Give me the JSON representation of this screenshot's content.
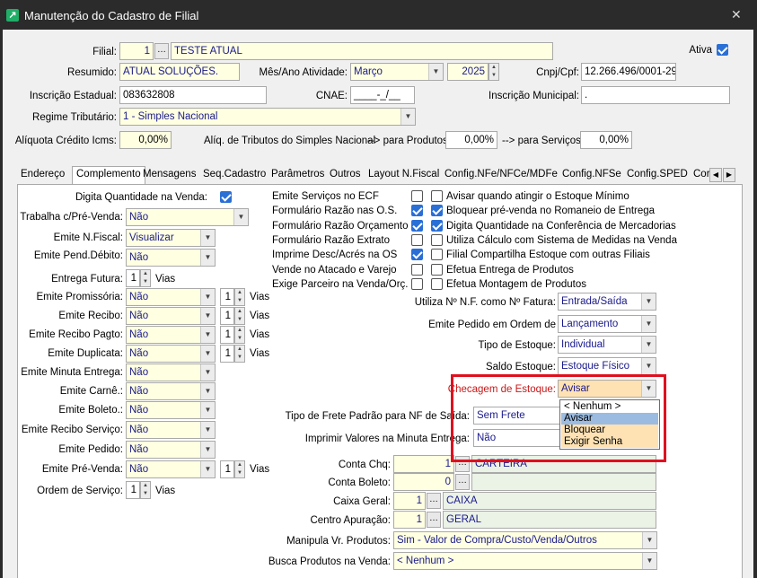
{
  "window": {
    "title": "Manutenção do Cadastro de Filial",
    "close_glyph": "✕"
  },
  "header": {
    "filial_label": "Filial:",
    "filial_code": "1",
    "filial_name": "TESTE ATUAL",
    "ativa_label": "Ativa",
    "resumido_label": "Resumido:",
    "resumido_value": "ATUAL SOLUÇÕES.",
    "mes_ano_label": "Mês/Ano Atividade:",
    "mes_value": "Março",
    "ano_value": "2025",
    "cnpj_label": "Cnpj/Cpf:",
    "cnpj_value": "12.266.496/0001-29",
    "ie_label": "Inscrição Estadual:",
    "ie_value": "083632808",
    "cnae_label": "CNAE:",
    "cnae_value": "____-_/__",
    "im_label": "Inscrição Municipal:",
    "im_value": ".",
    "regime_label": "Regime Tributário:",
    "regime_value": "1 - Simples Nacional",
    "aliq_icms_label": "Alíquota Crédito Icms:",
    "aliq_icms_value": "0,00%",
    "aliq_simples_label": "Alíq. de Tributos do Simples Nacional",
    "produtos_label": "--> para Produtos:",
    "produtos_value": "0,00%",
    "servicos_label": "--> para Serviços:",
    "servicos_value": "0,00%"
  },
  "tabs": [
    "Endereço",
    "Complemento",
    "Mensagens",
    "Seq.Cadastro",
    "Parâmetros",
    "Outros",
    "Layout N.Fiscal",
    "Config.NFe/NFCe/MDFe",
    "Config.NFSe",
    "Config.SPED",
    "Cor"
  ],
  "left": {
    "digita_qtd_label": "Digita Quantidade na Venda:",
    "trabalha_label": "Trabalha c/Pré-Venda:",
    "trabalha_value": "Não",
    "emite_nf_label": "Emite N.Fiscal:",
    "emite_nf_value": "Visualizar",
    "emite_pend_label": "Emite Pend.Débito:",
    "emite_pend_value": "Não",
    "entrega_label": "Entrega Futura:",
    "entrega_value": "1",
    "vias_label": "Vias",
    "rows": [
      {
        "label": "Emite Promissória:",
        "value": "Não",
        "vias": "1"
      },
      {
        "label": "Emite Recibo:",
        "value": "Não",
        "vias": "1"
      },
      {
        "label": "Emite Recibo Pagto:",
        "value": "Não",
        "vias": "1"
      },
      {
        "label": "Emite Duplicata:",
        "value": "Não",
        "vias": "1"
      },
      {
        "label": "Emite Minuta Entrega:",
        "value": "Não"
      },
      {
        "label": "Emite Carnê.:",
        "value": "Não"
      },
      {
        "label": "Emite Boleto.:",
        "value": "Não"
      },
      {
        "label": "Emite Recibo Serviço:",
        "value": "Não"
      },
      {
        "label": "Emite Pedido:",
        "value": "Não"
      },
      {
        "label": "Emite Pré-Venda:",
        "value": "Não",
        "vias": "1"
      }
    ],
    "ordem_label": "Ordem de Serviço:",
    "ordem_value": "1"
  },
  "middle_checks": [
    {
      "label": "Emite Serviços no ECF",
      "checked": false
    },
    {
      "label": "Formulário Razão nas O.S.",
      "checked": true
    },
    {
      "label": "Formulário Razão Orçamento",
      "checked": true
    },
    {
      "label": "Formulário Razão Extrato",
      "checked": false
    },
    {
      "label": "Imprime Desc/Acrés na OS",
      "checked": true
    },
    {
      "label": "Vende no Atacado e Varejo",
      "checked": false
    },
    {
      "label": "Exige Parceiro na Venda/Orç.",
      "checked": false
    }
  ],
  "right_checks": [
    {
      "label": "Avisar quando atingir o Estoque Mínimo",
      "checked": false
    },
    {
      "label": "Bloquear pré-venda no Romaneio de Entrega",
      "checked": true
    },
    {
      "label": "Digita Quantidade na Conferência de Mercadorias",
      "checked": true
    },
    {
      "label": "Utiliza Cálculo com Sistema de Medidas na Venda",
      "checked": false
    },
    {
      "label": "Filial Compartilha Estoque com outras Filiais",
      "checked": false
    },
    {
      "label": "Efetua Entrega de Produtos",
      "checked": false
    },
    {
      "label": "Efetua Montagem de Produtos",
      "checked": false
    }
  ],
  "right_fields": {
    "utiliza_nf_label": "Utiliza Nº N.F. como Nº Fatura:",
    "utiliza_nf_value": "Entrada/Saída",
    "emite_pedido_ordem_label": "Emite Pedido em Ordem de",
    "emite_pedido_ordem_value": "Lançamento",
    "tipo_estoque_label": "Tipo de Estoque:",
    "tipo_estoque_value": "Individual",
    "saldo_estoque_label": "Saldo Estoque:",
    "saldo_estoque_value": "Estoque Físico",
    "checagem_label": "Checagem de Estoque:",
    "checagem_value": "Avisar",
    "tipo_frete_label": "Tipo de Frete Padrão para NF de Saída:",
    "tipo_frete_value": "Sem Frete",
    "imprimir_label": "Imprimir Valores na Minuta Entrega:",
    "imprimir_value": "Não",
    "conta_chq_label": "Conta Chq:",
    "conta_chq_code": "1",
    "conta_chq_name": "CARTEIRA",
    "conta_boleto_label": "Conta Boleto:",
    "conta_boleto_code": "0",
    "caixa_label": "Caixa Geral:",
    "caixa_code": "1",
    "caixa_name": "CAIXA",
    "centro_label": "Centro Apuração:",
    "centro_code": "1",
    "centro_name": "GERAL",
    "manipula_label": "Manipula Vr. Produtos:",
    "manipula_value": "Sim - Valor de Compra/Custo/Venda/Outros",
    "busca_label": "Busca Produtos na Venda:",
    "busca_value": "< Nenhum >"
  },
  "dropdown_options": [
    "< Nenhum >",
    "Avisar",
    "Bloquear",
    "Exigir Senha"
  ],
  "colors": {
    "highlight_box": "#e0101e",
    "dropdown_selected": "#ffe2b3",
    "check_on": "#2a6fd6"
  }
}
